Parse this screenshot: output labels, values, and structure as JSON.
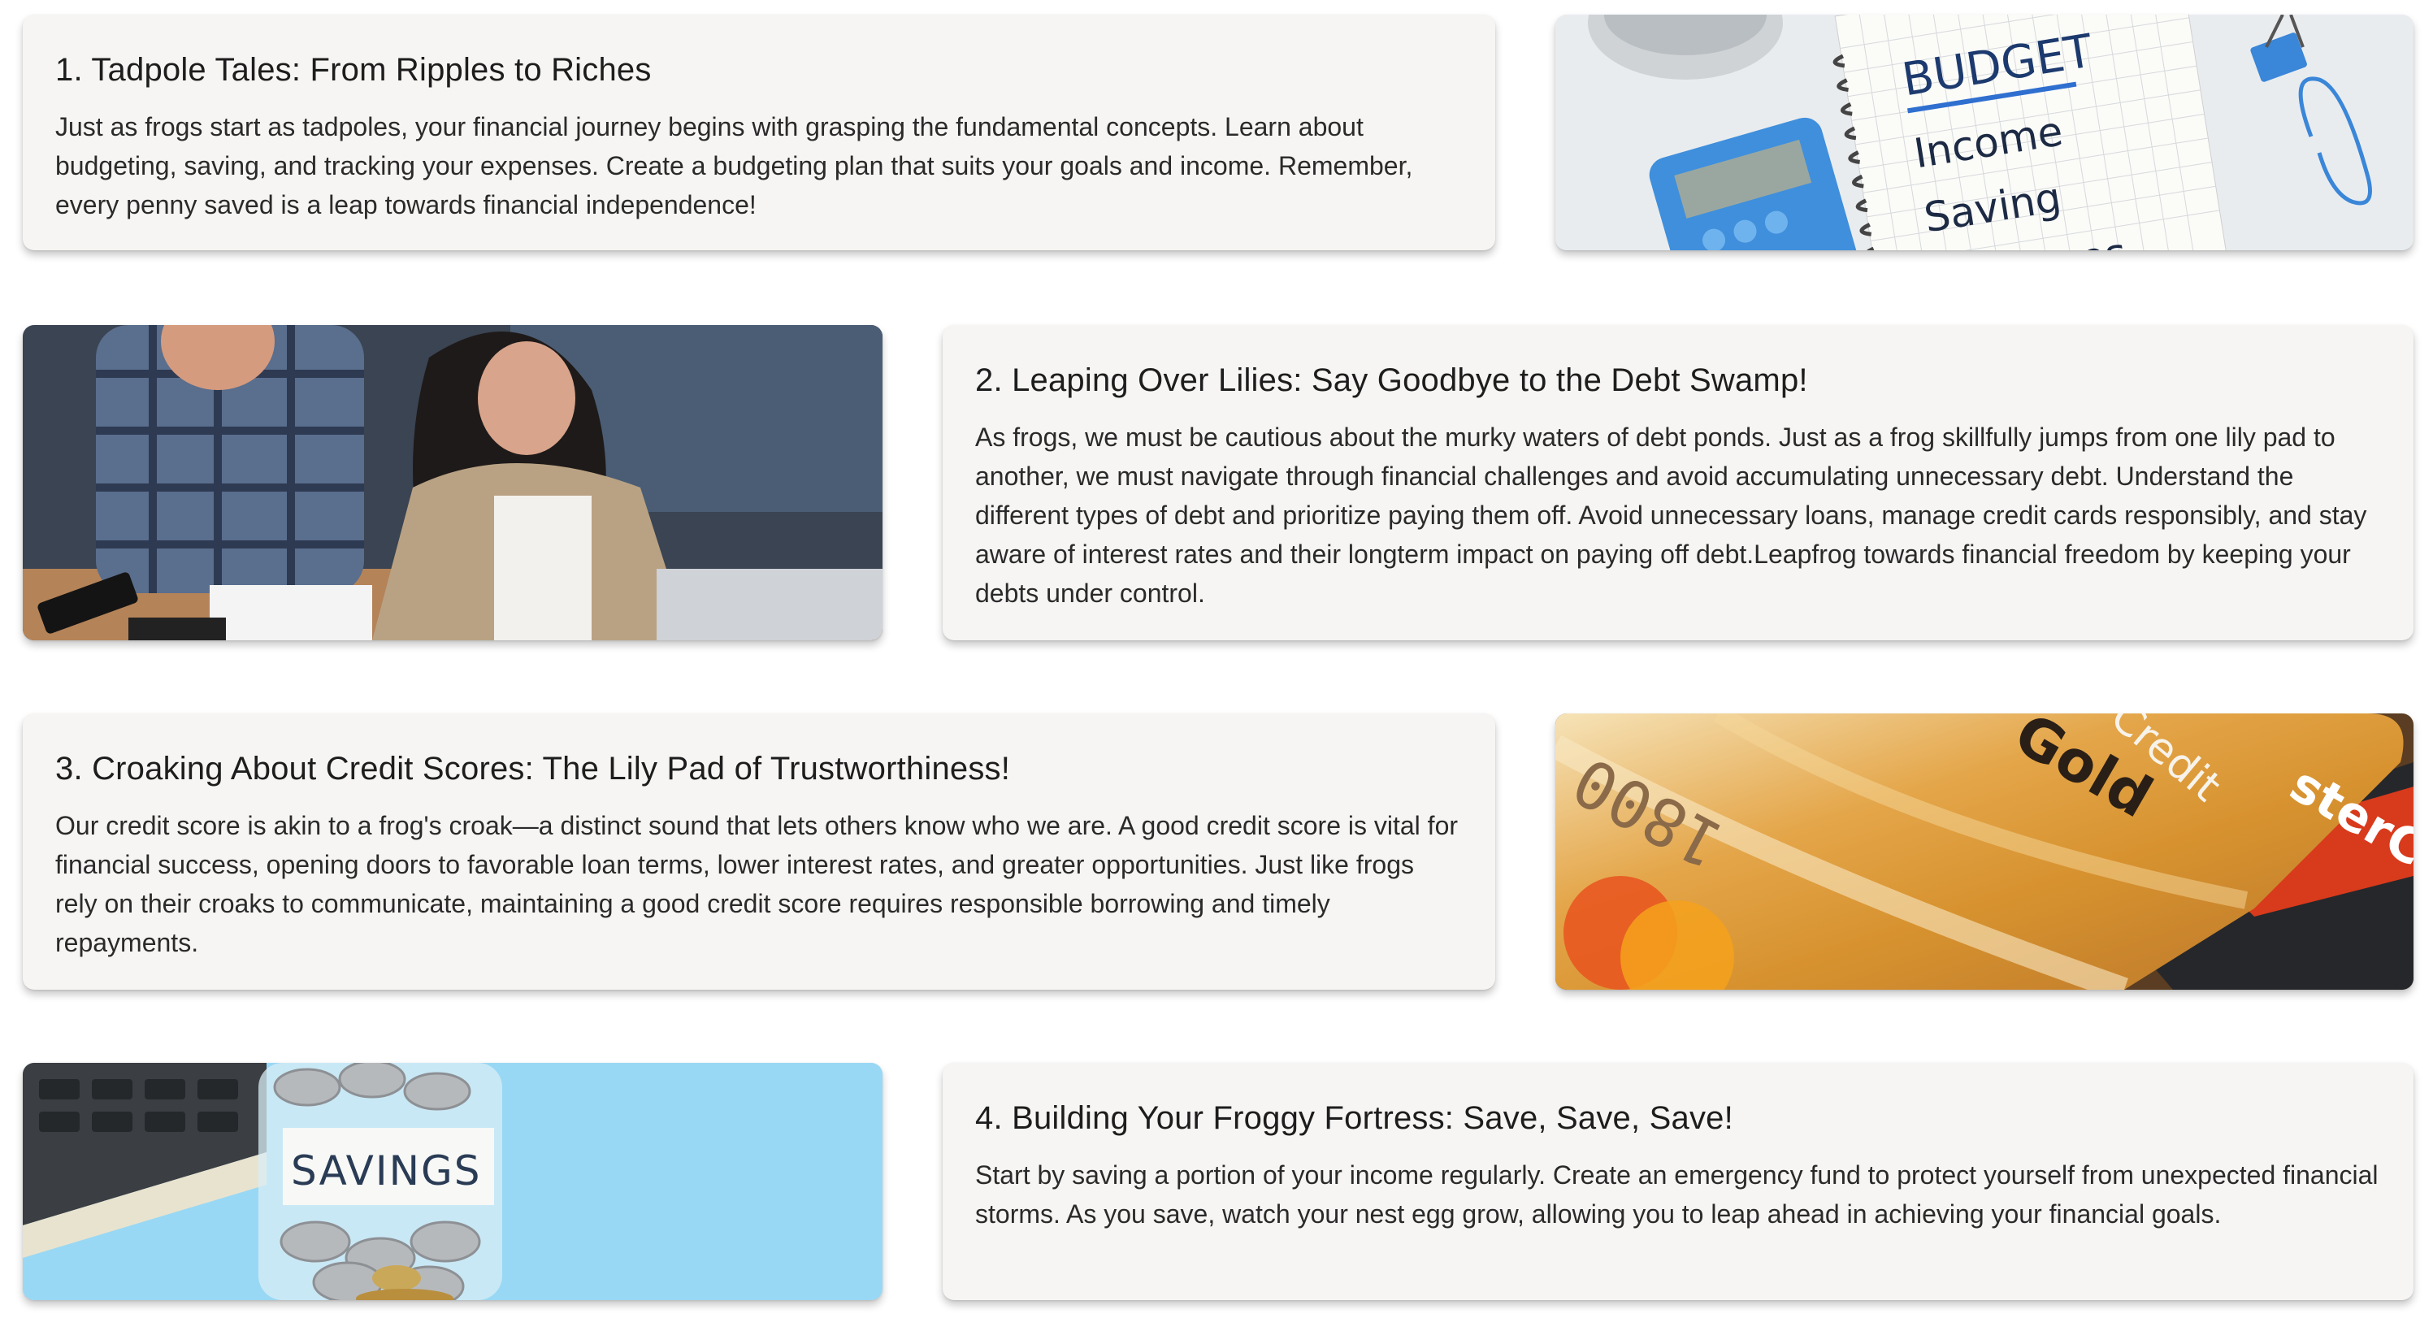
{
  "sections": [
    {
      "title": "1. Tadpole Tales: From Ripples to Riches",
      "body": "Just as frogs start as tadpoles, your financial journey begins with grasping the fundamental concepts. Learn about budgeting, saving, and tracking your expenses. Create a budgeting plan that suits your goals and income. Remember, every penny saved is a leap towards financial independence!",
      "image": {
        "icon": "budget-notebook-photo",
        "notebook_lines": [
          "BUDGET",
          "Income",
          "Saving",
          "Expenses"
        ]
      }
    },
    {
      "title": "2. Leaping Over Lilies: Say Goodbye to the Debt Swamp!",
      "body": "As frogs, we must be cautious about the murky waters of debt ponds. Just as a frog skillfully jumps from one lily pad to another, we must navigate through financial challenges and avoid accumulating unnecessary debt. Understand the different types of debt and prioritize paying them off. Avoid unnecessary loans, manage credit cards responsibly, and stay aware of interest rates and their longterm impact on paying off debt.Leapfrog towards financial freedom by keeping your debts under control.",
      "image": {
        "icon": "couple-reviewing-bills-photo"
      }
    },
    {
      "title": "3. Croaking About Credit Scores: The Lily Pad of Trustworthiness!",
      "body": "Our credit score is akin to a frog's croak—a distinct sound that lets others know who we are. A good credit score is vital for financial success, opening doors to favorable loan terms, lower interest rates, and greater opportunities. Just like frogs rely on their croaks to communicate, maintaining a good credit score requires responsible borrowing and timely repayments.",
      "image": {
        "icon": "credit-cards-photo",
        "card_texts": [
          "Credit",
          "Gold",
          "1800",
          "sterCa"
        ]
      }
    },
    {
      "title": "4. Building Your Froggy Fortress: Save, Save, Save!",
      "body": "Start by saving a portion of your income regularly. Create an emergency fund to protect yourself from unexpected financial storms. As you save, watch your nest egg grow, allowing you to leap ahead in achieving your financial goals.",
      "image": {
        "icon": "savings-jar-photo",
        "jar_label": "SAVINGS"
      }
    }
  ],
  "colors": {
    "card_bg": "#f6f5f3",
    "text": "#2a2a2a",
    "title": "#1d1d1d",
    "sky_blue": "#8fd3f2"
  }
}
